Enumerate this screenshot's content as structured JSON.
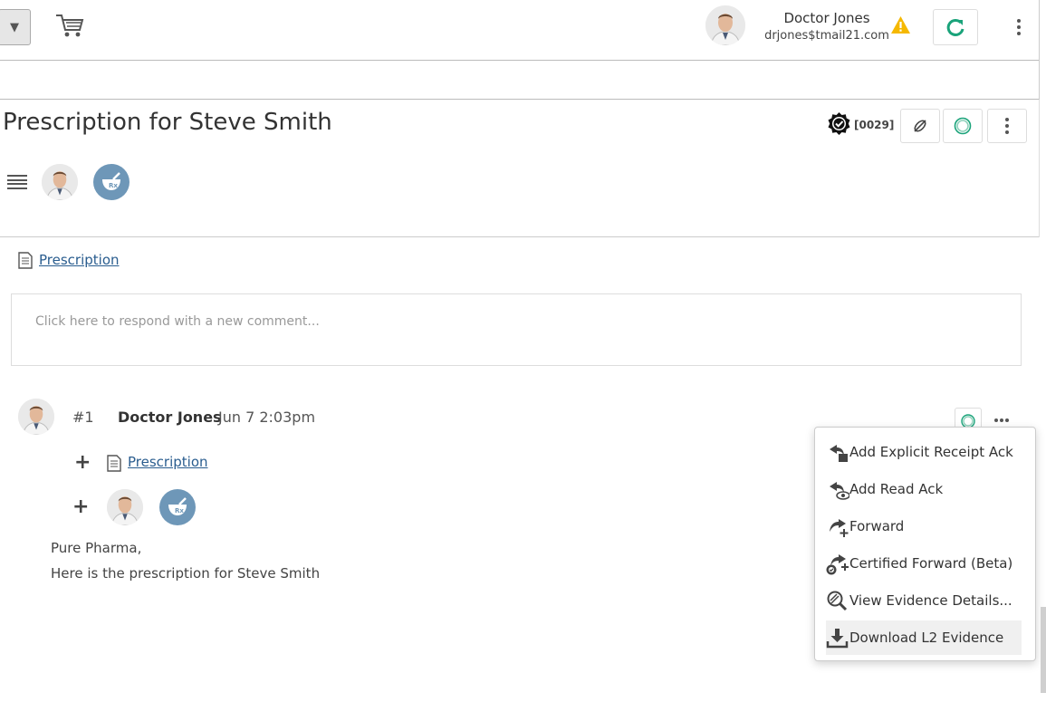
{
  "topbar": {
    "dropdown_glyph": "▼",
    "user_name": "Doctor Jones",
    "user_email": "drjones$tmail21.com",
    "icons": [
      "cart-icon",
      "warning-icon",
      "refresh-icon",
      "kebab-icon"
    ]
  },
  "thread": {
    "title": "Prescription for Steve Smith",
    "seq_label": "[0029]",
    "attachment_label": "Prescription",
    "comment_placeholder": "Click here to respond with a new comment..."
  },
  "message": {
    "number": "#1",
    "author": "Doctor Jones",
    "date": "Jun 7 2:03pm",
    "attachment_label": "Prescription",
    "body_lines": [
      "Pure Pharma,",
      "Here is the prescription for Steve Smith"
    ]
  },
  "menu": {
    "items": [
      {
        "label": "Add Explicit Receipt Ack",
        "icon": "receipt-ack-icon"
      },
      {
        "label": "Add Read Ack",
        "icon": "read-ack-icon"
      },
      {
        "label": "Forward",
        "icon": "forward-icon"
      },
      {
        "label": "Certified Forward (Beta)",
        "icon": "certified-forward-icon"
      },
      {
        "label": "View Evidence Details...",
        "icon": "evidence-search-icon"
      },
      {
        "label": "Download L2 Evidence",
        "icon": "download-icon"
      }
    ]
  },
  "colors": {
    "link": "#2a5d8f",
    "accent_green": "#1aa37a",
    "warning": "#f5b800",
    "rx_badge": "#6e97b8"
  }
}
